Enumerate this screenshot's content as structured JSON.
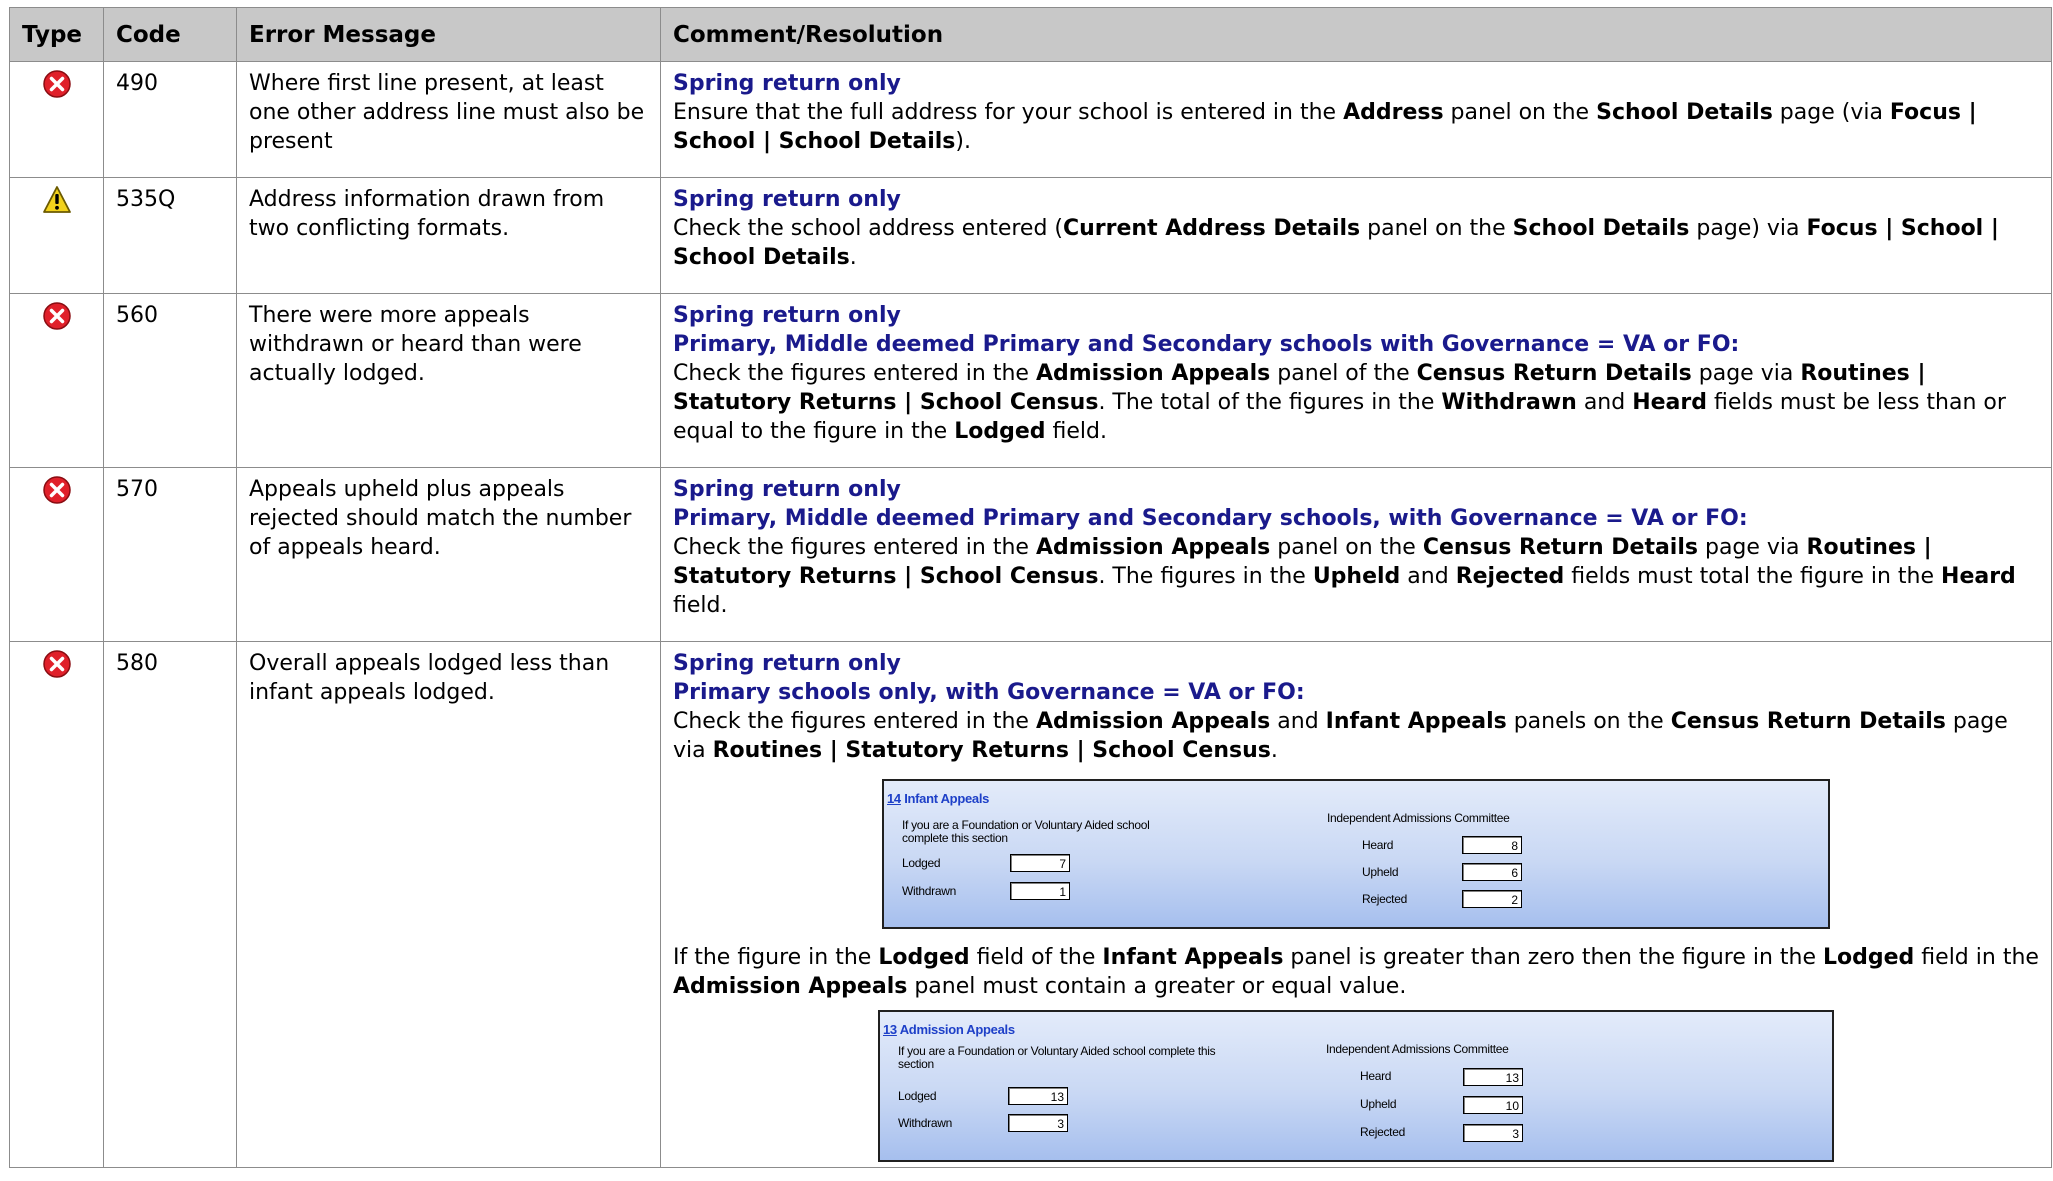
{
  "headers": {
    "type": "Type",
    "code": "Code",
    "message": "Error Message",
    "comment": "Comment/Resolution"
  },
  "colors": {
    "error": "#e0202a",
    "warning": "#f2d21c",
    "header_bg": "#c8c8c8",
    "accent_blue": "#1a1a8c"
  },
  "rows": [
    {
      "icon": "error-icon",
      "code": "490",
      "message": "Where first line present, at least one other address line must also be present",
      "heading1": "Spring return only",
      "t1": "Ensure that the full address for your school is entered in the ",
      "b1": "Address",
      "t2": " panel on the ",
      "b2": "School Details",
      "t3": " page (via ",
      "b3": "Focus | School | School Details",
      "t4": ")."
    },
    {
      "icon": "warning-icon",
      "code": "535Q",
      "message": "Address information drawn from two conflicting formats.",
      "heading1": "Spring return only",
      "t1": "Check the school address entered (",
      "b1": "Current Address Details",
      "t2": " panel on the ",
      "b2": "School Details",
      "t3": " page) via ",
      "b3": "Focus | School | School Details",
      "t4": "."
    },
    {
      "icon": "error-icon",
      "code": "560",
      "message": "There were more appeals withdrawn or heard than were actually lodged.",
      "heading1": "Spring return only",
      "heading2": "Primary, Middle deemed Primary and Secondary schools with Governance = VA or FO:",
      "t1": "Check the figures entered in the ",
      "b1": "Admission Appeals",
      "t2": " panel of the ",
      "b2": "Census Return Details",
      "t3": " page via ",
      "b3": "Routines | Statutory Returns | School Census",
      "t4": ". The total of the figures in the ",
      "b4": "Withdrawn",
      "t5": " and ",
      "b5": "Heard",
      "t6": " fields must be less than or equal to the figure in the ",
      "b6": "Lodged",
      "t7": " field."
    },
    {
      "icon": "error-icon",
      "code": "570",
      "message": "Appeals upheld plus appeals rejected should match the number of appeals heard.",
      "heading1": "Spring return only",
      "heading2": "Primary, Middle deemed Primary and Secondary schools, with Governance = VA or FO:",
      "t1": "Check the figures entered in the ",
      "b1": "Admission Appeals",
      "t2": " panel on the ",
      "b2": "Census Return Details",
      "t3": " page via ",
      "b3": "Routines | Statutory Returns | School Census",
      "t4": ". The figures in the ",
      "b4": "Upheld",
      "t5": " and ",
      "b5": "Rejected",
      "t6": " fields must total the figure in the ",
      "b6": "Heard",
      "t7": " field."
    },
    {
      "icon": "error-icon",
      "code": "580",
      "message": "Overall appeals lodged less than infant appeals lodged.",
      "heading1": "Spring return only",
      "heading2": "Primary schools only, with Governance = VA or FO:",
      "t1": "Check the figures entered in the ",
      "b1": "Admission Appeals",
      "t2": " and ",
      "b2": "Infant Appeals",
      "t3": " panels on the ",
      "b3": "Census Return Details",
      "t4": " page via ",
      "b4": "Routines | Statutory Returns | School Census",
      "t5": ".",
      "p2_t1": "If the figure in the ",
      "p2_b1": "Lodged",
      "p2_t2": " field of the ",
      "p2_b2": "Infant Appeals",
      "p2_t3": " panel is greater than zero then the figure in the ",
      "p2_b3": "Lodged",
      "p2_t4": " field in the ",
      "p2_b4": "Admission Appeals",
      "p2_t5": " panel must contain a greater or equal value."
    }
  ],
  "panel_infant": {
    "num": "14",
    "title": "Infant Appeals",
    "intro": "If you are a Foundation or Voluntary Aided school complete this section",
    "iac": "Independent Admissions Committee",
    "lodged_label": "Lodged",
    "lodged": "7",
    "withdrawn_label": "Withdrawn",
    "withdrawn": "1",
    "heard_label": "Heard",
    "heard": "8",
    "upheld_label": "Upheld",
    "upheld": "6",
    "rejected_label": "Rejected",
    "rejected": "2"
  },
  "panel_admission": {
    "num": "13",
    "title": "Admission Appeals",
    "intro": "If you are a Foundation or Voluntary Aided school complete this section",
    "iac": "Independent Admissions Committee",
    "lodged_label": "Lodged",
    "lodged": "13",
    "withdrawn_label": "Withdrawn",
    "withdrawn": "3",
    "heard_label": "Heard",
    "heard": "13",
    "upheld_label": "Upheld",
    "upheld": "10",
    "rejected_label": "Rejected",
    "rejected": "3"
  }
}
